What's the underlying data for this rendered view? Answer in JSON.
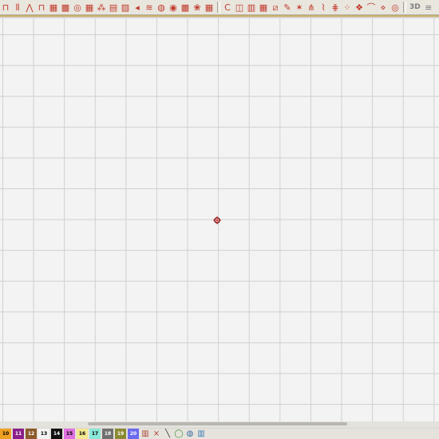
{
  "toolbar": {
    "buttons": [
      {
        "name": "running-stitch-icon",
        "glyph": "⊓"
      },
      {
        "name": "satin-stitch-icon",
        "glyph": "⫴"
      },
      {
        "name": "zigzag-stitch-icon",
        "glyph": "⋀"
      },
      {
        "name": "triple-stitch-icon",
        "glyph": "⊓"
      },
      {
        "name": "fill-pattern-icon",
        "glyph": "▦"
      },
      {
        "name": "fill-pattern-2-icon",
        "glyph": "▩"
      },
      {
        "name": "circle-fill-icon",
        "glyph": "◎"
      },
      {
        "name": "grid-fill-icon",
        "glyph": "▦"
      },
      {
        "name": "dot-fill-icon",
        "glyph": "⁂"
      },
      {
        "name": "stair-fill-icon",
        "glyph": "▤"
      },
      {
        "name": "diagonal-fill-icon",
        "glyph": "▨"
      },
      {
        "name": "arrow-fill-icon",
        "glyph": "◂"
      },
      {
        "name": "wave-fill-icon",
        "glyph": "≋"
      },
      {
        "name": "round-fill-icon",
        "glyph": "◍"
      },
      {
        "name": "radial-fill-icon",
        "glyph": "◉"
      },
      {
        "name": "lattice-fill-icon",
        "glyph": "▩"
      },
      {
        "name": "flower-fill-icon",
        "glyph": "❀"
      },
      {
        "name": "net-fill-icon",
        "glyph": "▦"
      }
    ],
    "buttons_group2": [
      {
        "name": "letter-c-icon",
        "glyph": "C"
      },
      {
        "name": "square-tool-icon",
        "glyph": "◫"
      },
      {
        "name": "brick-pattern-icon",
        "glyph": "▥"
      },
      {
        "name": "grid-pattern-icon",
        "glyph": "▦"
      },
      {
        "name": "line-pattern-icon",
        "glyph": "⧄"
      },
      {
        "name": "leaf-tool-icon",
        "glyph": "✎"
      },
      {
        "name": "star-tool-icon",
        "glyph": "✶"
      },
      {
        "name": "fan-tool-icon",
        "glyph": "⋔"
      },
      {
        "name": "needle-tool-icon",
        "glyph": "⌇"
      },
      {
        "name": "comb-tool-icon",
        "glyph": "⋕"
      },
      {
        "name": "dots-grid-icon",
        "glyph": "⁘"
      },
      {
        "name": "diamond-grid-icon",
        "glyph": "❖"
      },
      {
        "name": "curve-tool-icon",
        "glyph": "⌒"
      },
      {
        "name": "stitch-preview-icon",
        "glyph": "⋄"
      },
      {
        "name": "hoop-icon",
        "glyph": "◎"
      }
    ],
    "view3d_label": "3D"
  },
  "palette": {
    "swatches": [
      {
        "label": "10",
        "bg": "#f0a020",
        "fg": "#000000"
      },
      {
        "label": "11",
        "bg": "#8a1e8a",
        "fg": "#ffffff"
      },
      {
        "label": "12",
        "bg": "#8a5a2a",
        "fg": "#ffffff"
      },
      {
        "label": "13",
        "bg": "#f4f4f4",
        "fg": "#000000"
      },
      {
        "label": "14",
        "bg": "#111111",
        "fg": "#ffffff"
      },
      {
        "label": "15",
        "bg": "#e070e0",
        "fg": "#000000"
      },
      {
        "label": "16",
        "bg": "#f4e890",
        "fg": "#000000"
      },
      {
        "label": "17",
        "bg": "#8ae8d8",
        "fg": "#000000"
      },
      {
        "label": "18",
        "bg": "#707070",
        "fg": "#ffffff"
      },
      {
        "label": "19",
        "bg": "#8a8a30",
        "fg": "#ffffff"
      },
      {
        "label": "20",
        "bg": "#6a6af0",
        "fg": "#ffffff"
      }
    ]
  },
  "colors": {
    "accent": "#c0392b",
    "grid": "#d0d0d0",
    "canvas": "#f3f3f3"
  }
}
